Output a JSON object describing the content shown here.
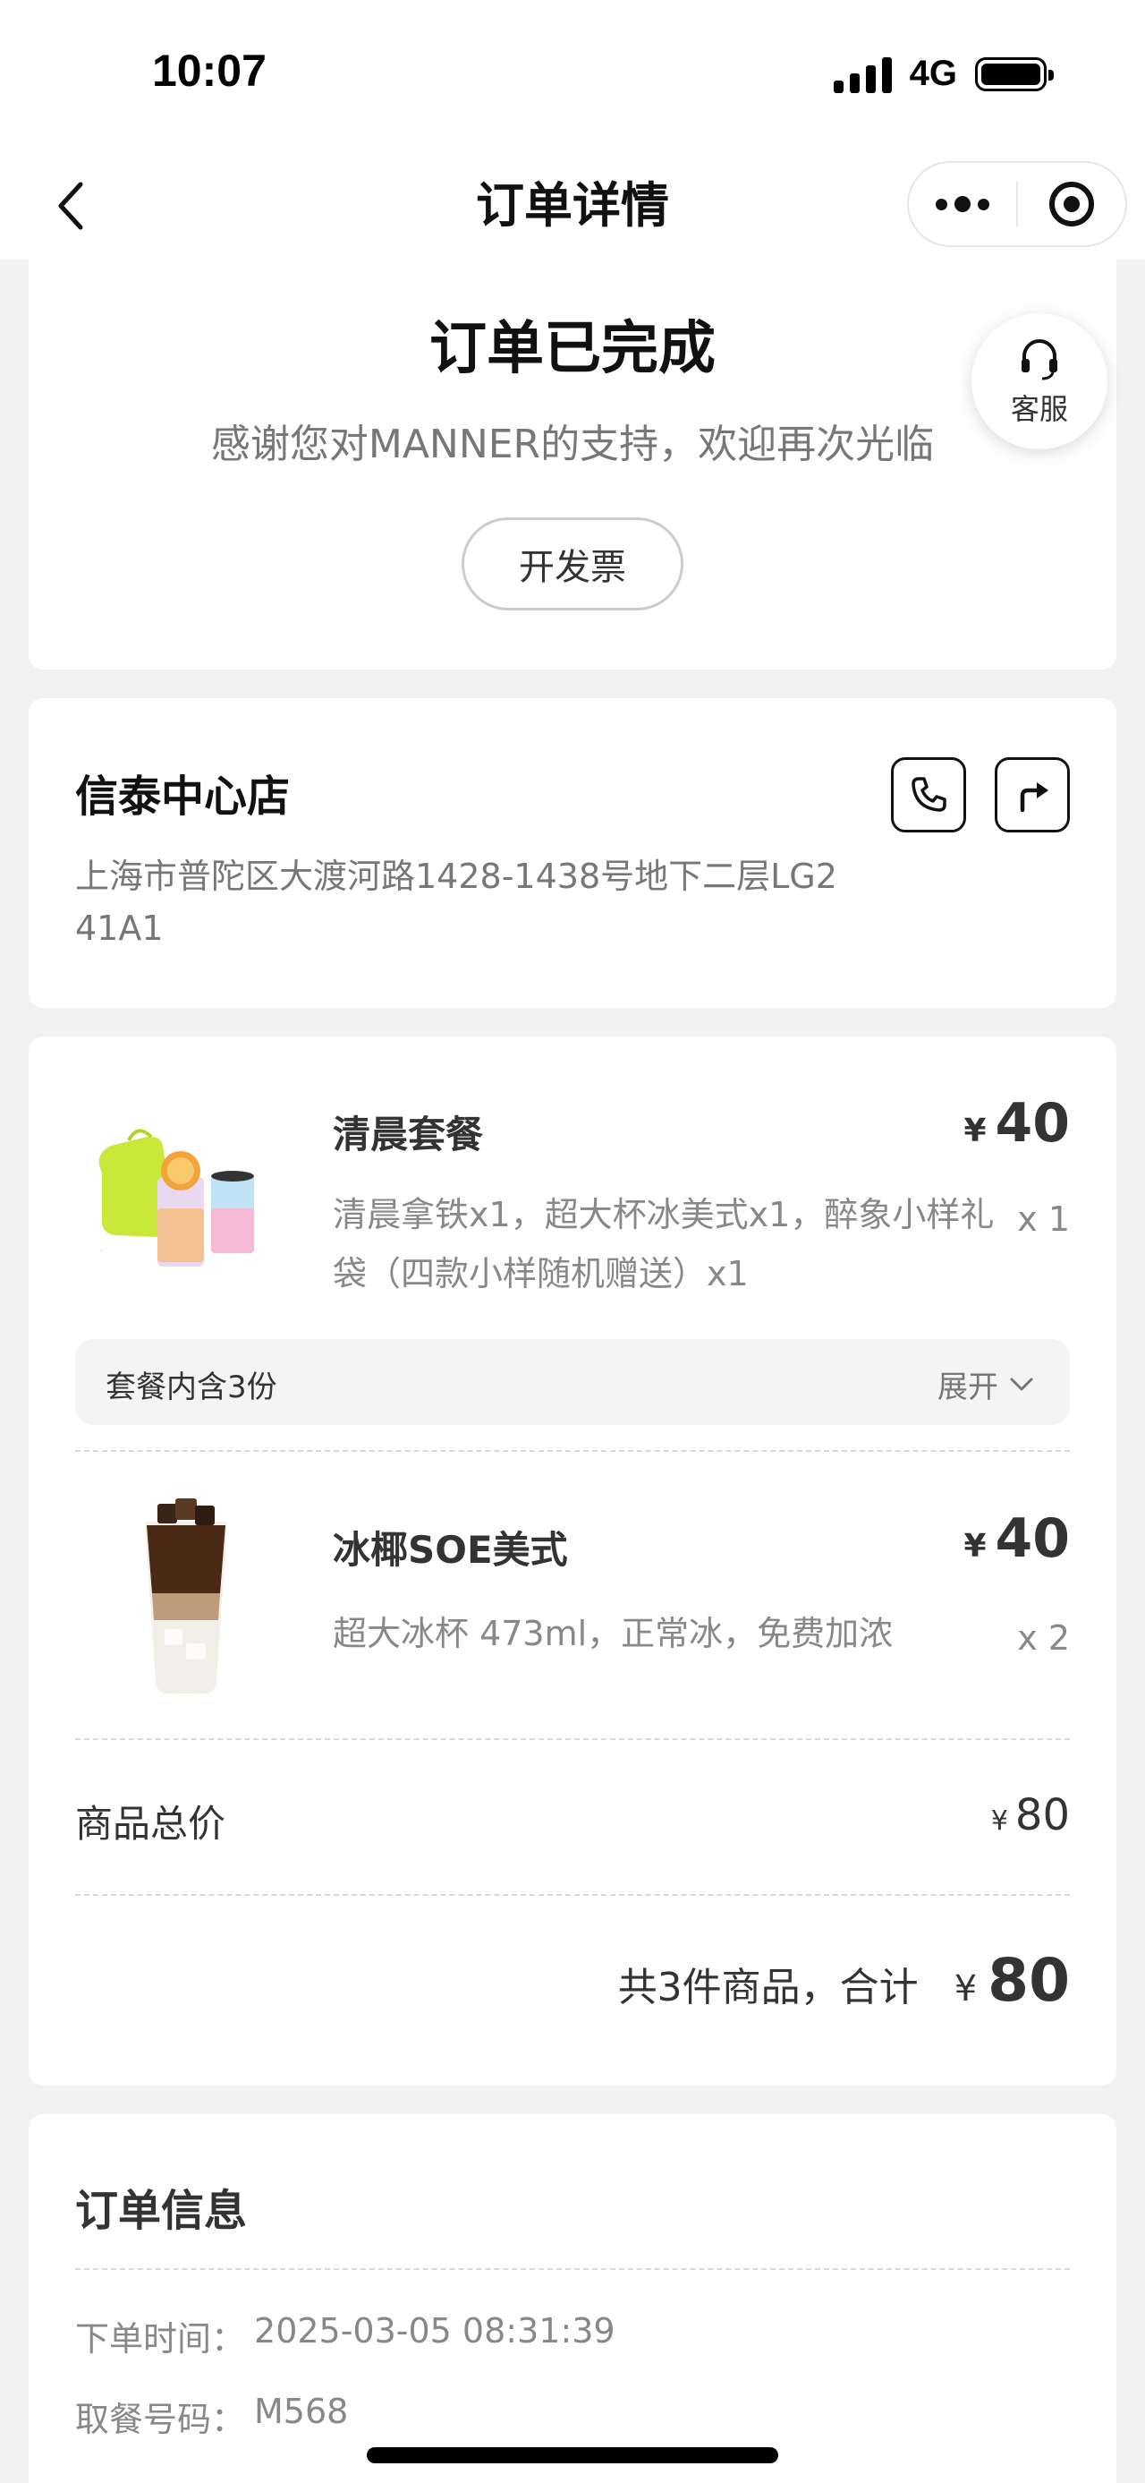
{
  "status_bar": {
    "time": "10:07",
    "network": "4G"
  },
  "nav": {
    "title": "订单详情"
  },
  "order_status": {
    "title": "订单已完成",
    "subtitle": "感谢您对MANNER的支持，欢迎再次光临",
    "invoice_button": "开发票",
    "customer_service": "客服"
  },
  "store": {
    "name": "信泰中心店",
    "address": "上海市普陀区大渡河路1428-1438号地下二层LG2 41A1"
  },
  "items": [
    {
      "name": "清晨套餐",
      "currency": "¥",
      "price": "40",
      "description": "清晨拿铁x1，超大杯冰美式x1，醉象小样礼袋（四款小样随机赠送）x1",
      "quantity": "x 1",
      "set_info": "套餐内含3份",
      "expand_label": "展开"
    },
    {
      "name": "冰椰SOE美式",
      "currency": "¥",
      "price": "40",
      "description": "超大冰杯 473ml，正常冰，免费加浓",
      "quantity": "x 2"
    }
  ],
  "summary": {
    "subtotal_label": "商品总价",
    "subtotal_currency": "¥",
    "subtotal_value": "80",
    "total_text": "共3件商品，合计",
    "total_currency": "¥",
    "total_value": "80"
  },
  "order_info": {
    "title": "订单信息",
    "rows": [
      {
        "label": "下单时间：",
        "value": "2025-03-05 08:31:39"
      },
      {
        "label": "取餐号码：",
        "value": "M568"
      }
    ]
  }
}
